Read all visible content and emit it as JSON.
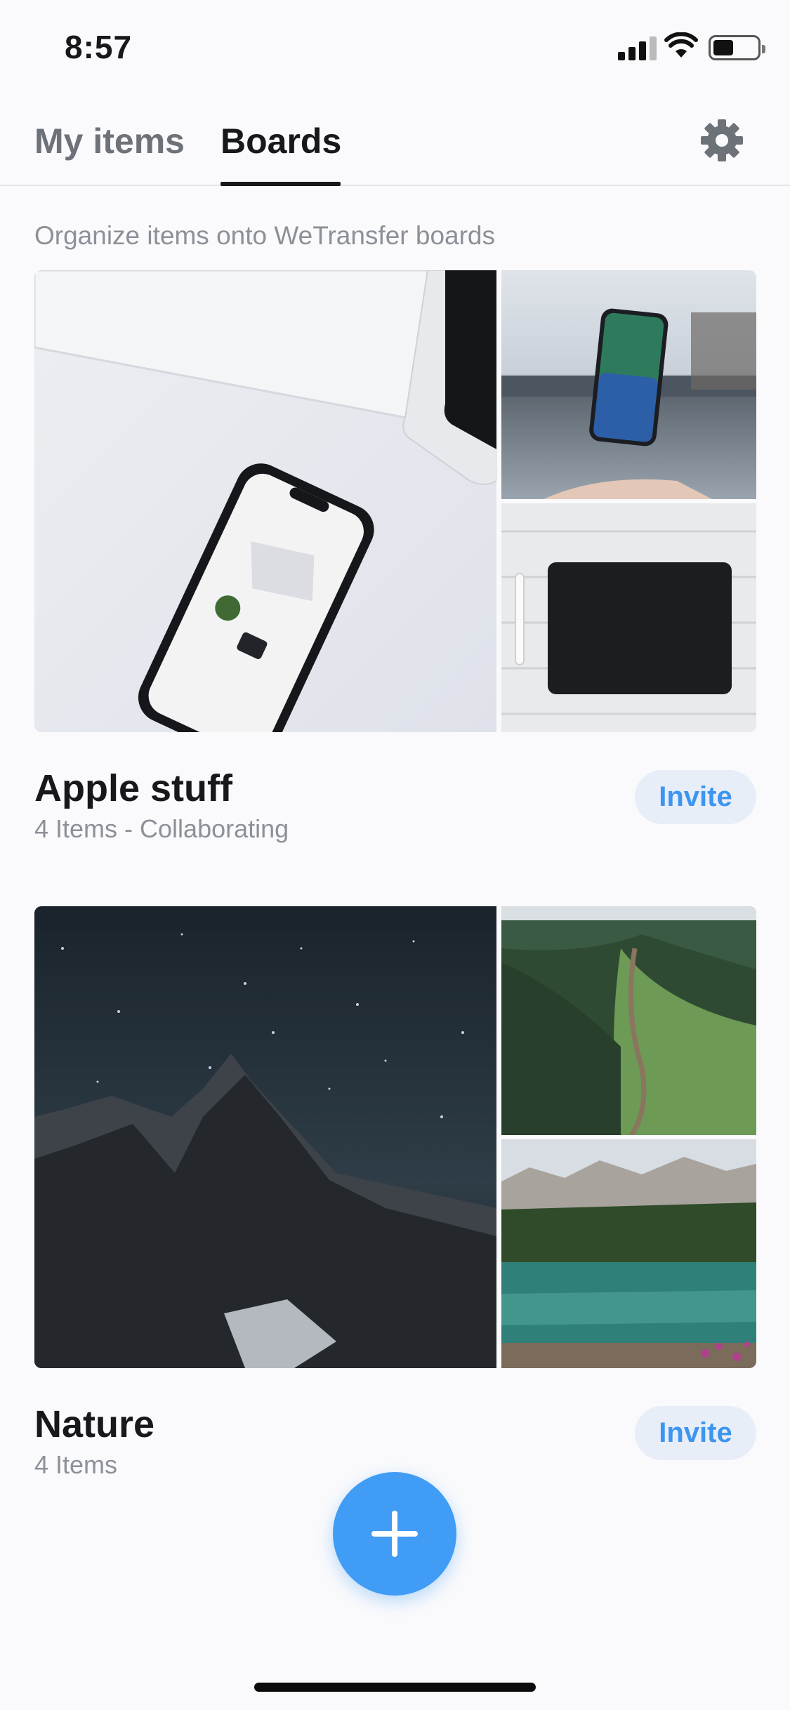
{
  "status_bar": {
    "time": "8:57",
    "icons": [
      "cellular-signal-icon",
      "wifi-icon",
      "battery-icon"
    ]
  },
  "tabs": [
    {
      "label": "My items",
      "active": false
    },
    {
      "label": "Boards",
      "active": true
    }
  ],
  "settings_icon": "gear-icon",
  "subtitle": "Organize items onto WeTransfer boards",
  "boards": [
    {
      "title": "Apple stuff",
      "meta": "4 Items - Collaborating",
      "invite_label": "Invite",
      "images": [
        "iphone-on-white-desk-photo",
        "floating-iphone-over-lake-photo",
        "black-ipad-with-pencil-photo"
      ]
    },
    {
      "title": "Nature",
      "meta": "4 Items",
      "invite_label": "Invite",
      "images": [
        "night-sky-mountains-photo",
        "green-mountain-trail-photo",
        "alpine-lake-forest-photo"
      ]
    }
  ],
  "fab_icon": "plus-icon",
  "colors": {
    "accent": "#409cf5",
    "invite_text": "#3d95f0",
    "invite_bg": "#e8eef8",
    "text_primary": "#17181a",
    "text_secondary": "#8c9098"
  }
}
